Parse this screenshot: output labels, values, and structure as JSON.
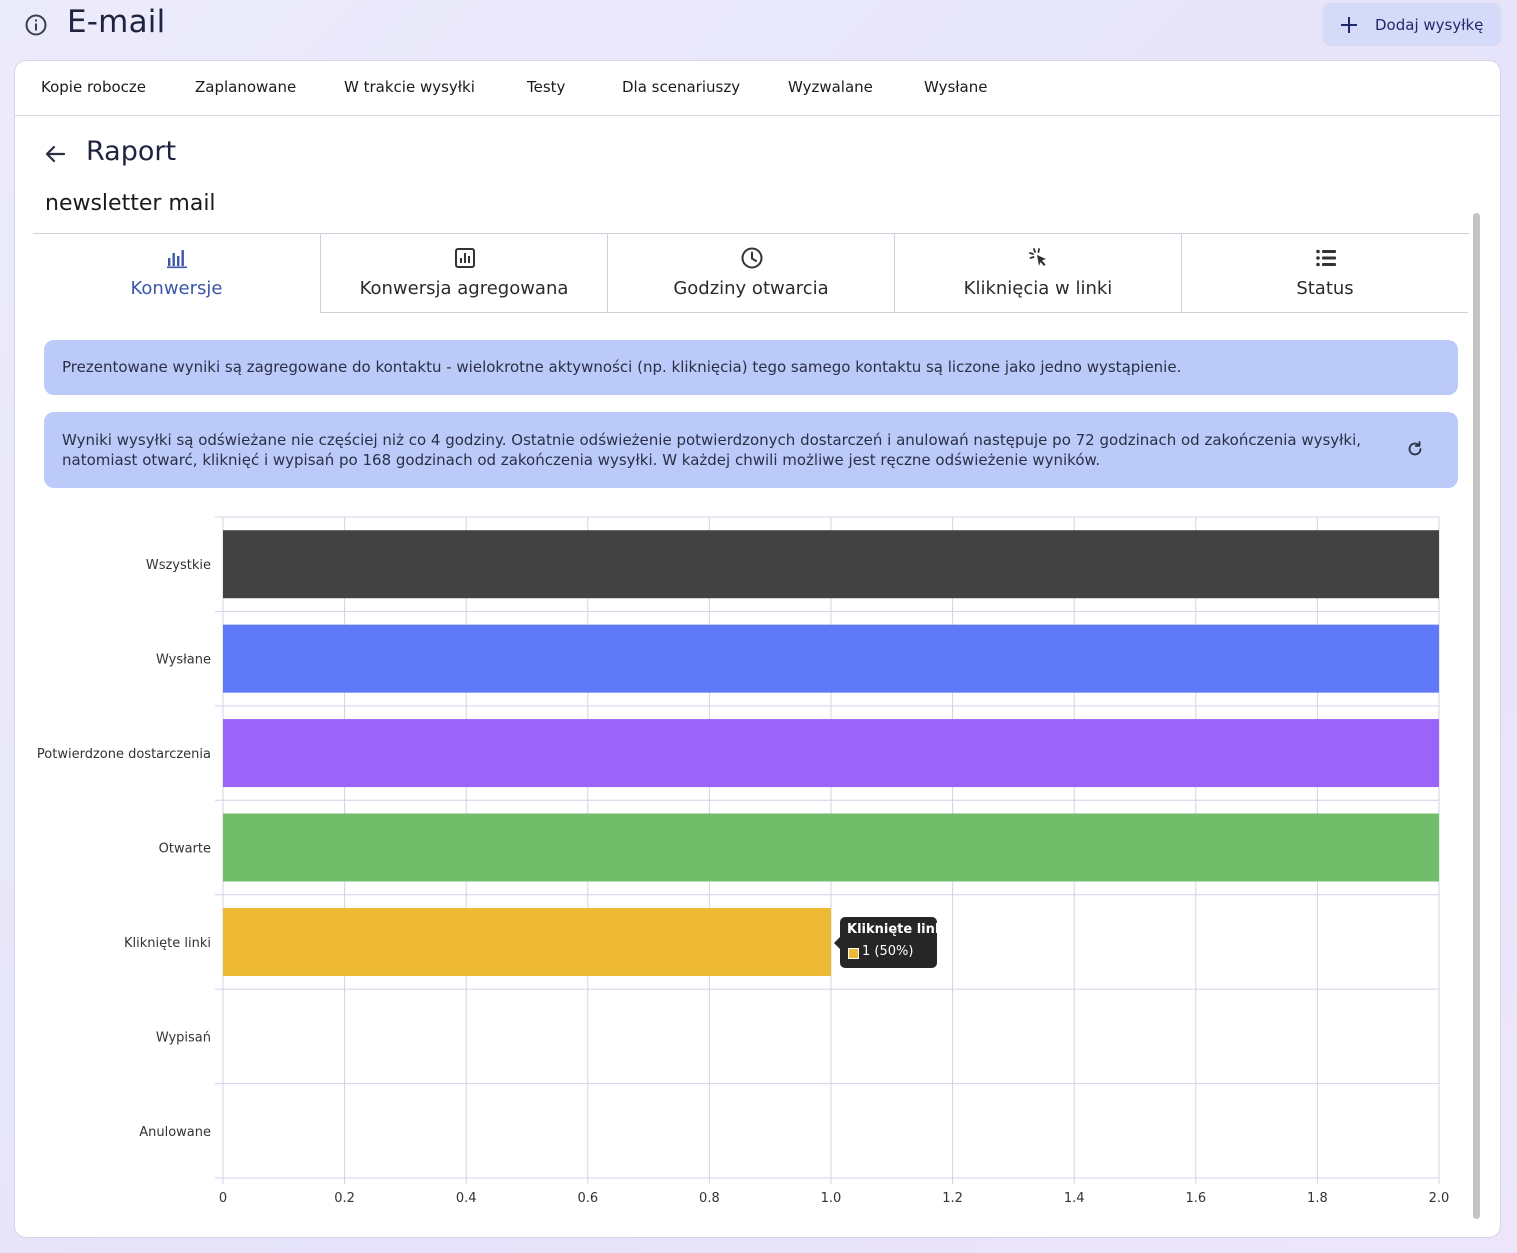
{
  "header": {
    "info_icon": "info-circle-icon",
    "title": "E-mail",
    "add_button_label": "Dodaj wysyłkę",
    "add_icon": "plus-icon"
  },
  "nav_tabs": [
    {
      "label": "Kopie robocze"
    },
    {
      "label": "Zaplanowane"
    },
    {
      "label": "W trakcie wysyłki"
    },
    {
      "label": "Testy"
    },
    {
      "label": "Dla scenariuszy"
    },
    {
      "label": "Wyzwalane"
    },
    {
      "label": "Wysłane"
    }
  ],
  "report": {
    "back_icon": "arrow-left-icon",
    "title": "Raport",
    "mail_name": "newsletter mail"
  },
  "sub_tabs": [
    {
      "label": "Konwersje",
      "icon": "bar-chart-icon",
      "active": true
    },
    {
      "label": "Konwersja agregowana",
      "icon": "chart-box-icon",
      "active": false
    },
    {
      "label": "Godziny otwarcia",
      "icon": "clock-icon",
      "active": false
    },
    {
      "label": "Kliknięcia w linki",
      "icon": "cursor-click-icon",
      "active": false
    },
    {
      "label": "Status",
      "icon": "list-icon",
      "active": false
    }
  ],
  "notices": {
    "aggregation": "Prezentowane wyniki są zagregowane do kontaktu - wielokrotne aktywności (np. kliknięcia) tego samego kontaktu są liczone jako jedno wystąpienie.",
    "refresh": "Wyniki wysyłki są odświeżane nie częściej niż co 4 godziny. Ostatnie odświeżenie potwierdzonych dostarczeń i anulowań następuje po 72 godzinach od zakończenia wysyłki, natomiast otwarć, kliknięć i wypisań po 168 godzinach od zakończenia wysyłki. W każdej chwili możliwe jest ręczne odświeżenie wyników.",
    "refresh_icon": "refresh-icon"
  },
  "colors": {
    "active_tab": "#3b57a8",
    "notice_bg": "#bccafa"
  },
  "chart_data": {
    "type": "bar",
    "orientation": "horizontal",
    "categories": [
      "Wszystkie",
      "Wysłane",
      "Potwierdzone dostarczenia",
      "Otwarte",
      "Kliknięte linki",
      "Wypisań",
      "Anulowane"
    ],
    "values": [
      2,
      2,
      2,
      2,
      1,
      0,
      0
    ],
    "colors": [
      "#424242",
      "#5f79f9",
      "#9964f7",
      "#72bd69",
      "#eeb933",
      "#e05a5a",
      "#9e9e9e"
    ],
    "xlim": [
      0,
      2
    ],
    "xticks": [
      "0",
      "0.2",
      "0.4",
      "0.6",
      "0.8",
      "1.0",
      "1.2",
      "1.4",
      "1.6",
      "1.8",
      "2.0"
    ],
    "grid": true,
    "tooltip": {
      "title": "Kliknięte linki",
      "value": "1 (50%)"
    }
  }
}
